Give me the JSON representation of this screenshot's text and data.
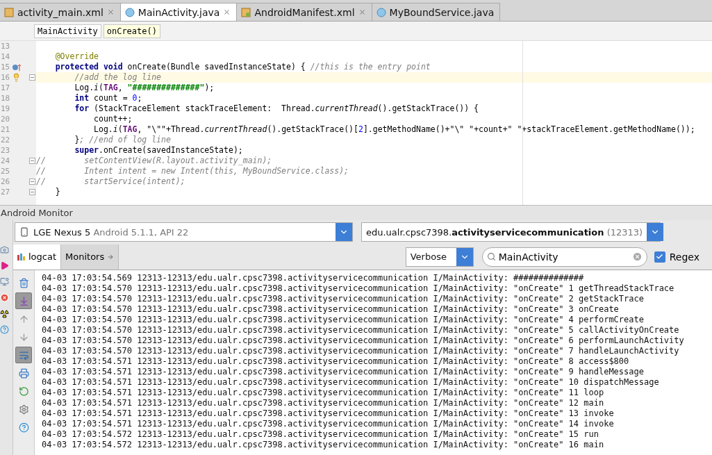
{
  "editor_tabs": [
    {
      "label": "activity_main.xml",
      "kind": "xml",
      "selected": false,
      "closable": true
    },
    {
      "label": "MainActivity.java",
      "kind": "class",
      "selected": true,
      "closable": true
    },
    {
      "label": "AndroidManifest.xml",
      "kind": "manifest",
      "selected": false,
      "closable": true
    },
    {
      "label": "MyBoundService.java",
      "kind": "class",
      "selected": false,
      "closable": false
    }
  ],
  "breadcrumbs": [
    {
      "label": "MainActivity",
      "selected": false
    },
    {
      "label": "onCreate()",
      "selected": true
    }
  ],
  "code_lines": [
    {
      "number": "13",
      "kind": "plain",
      "current": false,
      "fold": false
    },
    {
      "number": "14",
      "kind": "plain",
      "current": false,
      "fold": false,
      "tokens": [
        {
          "kind": "ann",
          "t": "    @Override"
        }
      ]
    },
    {
      "number": "15",
      "kind": "override",
      "current": false,
      "fold": false,
      "tokens": [
        {
          "kind": "kw",
          "t": "    protected void"
        },
        {
          "kind": "plain",
          "t": " onCreate(Bundle savedInstanceState) { "
        },
        {
          "kind": "comment",
          "t": "//this is the entry point"
        }
      ]
    },
    {
      "number": "16",
      "kind": "bulb",
      "current": true,
      "fold": true,
      "tokens": [
        {
          "kind": "comment",
          "t": "        //add the log line"
        }
      ]
    },
    {
      "number": "17",
      "kind": "plain",
      "current": false,
      "fold": false,
      "tokens": [
        {
          "kind": "plain",
          "t": "        Log."
        },
        {
          "kind": "static",
          "t": "i"
        },
        {
          "kind": "plain",
          "t": "("
        },
        {
          "kind": "field",
          "t": "TAG"
        },
        {
          "kind": "plain",
          "t": ", "
        },
        {
          "kind": "str",
          "t": "\"##############\""
        },
        {
          "kind": "plain",
          "t": ");"
        }
      ]
    },
    {
      "number": "18",
      "kind": "plain",
      "current": false,
      "fold": false,
      "tokens": [
        {
          "kind": "kw",
          "t": "        int"
        },
        {
          "kind": "plain",
          "t": " count = "
        },
        {
          "kind": "num",
          "t": "0"
        },
        {
          "kind": "plain",
          "t": ";"
        }
      ]
    },
    {
      "number": "19",
      "kind": "plain",
      "current": false,
      "fold": false,
      "tokens": [
        {
          "kind": "kw",
          "t": "        for"
        },
        {
          "kind": "plain",
          "t": " (StackTraceElement stackTraceElement:  Thread."
        },
        {
          "kind": "static",
          "t": "currentThread"
        },
        {
          "kind": "plain",
          "t": "().getStackTrace()) {"
        }
      ]
    },
    {
      "number": "20",
      "kind": "plain",
      "current": false,
      "fold": false,
      "tokens": [
        {
          "kind": "plain",
          "t": "            count++;"
        }
      ]
    },
    {
      "number": "21",
      "kind": "plain",
      "current": false,
      "fold": false,
      "tokens": [
        {
          "kind": "plain",
          "t": "            Log."
        },
        {
          "kind": "static",
          "t": "i"
        },
        {
          "kind": "plain",
          "t": "("
        },
        {
          "kind": "field",
          "t": "TAG"
        },
        {
          "kind": "plain",
          "t": ", \"\\\"\"+Thread."
        },
        {
          "kind": "static",
          "t": "currentThread"
        },
        {
          "kind": "plain",
          "t": "().getStackTrace()["
        },
        {
          "kind": "num",
          "t": "2"
        },
        {
          "kind": "plain",
          "t": "].getMethodName()+\"\\\" \"+count+\" \"+stackTraceElement.getMethodName());"
        }
      ]
    },
    {
      "number": "22",
      "kind": "plain",
      "current": false,
      "fold": false,
      "tokens": [
        {
          "kind": "plain",
          "t": "        }"
        },
        {
          "kind": "comment",
          "t": "; //end of log line"
        }
      ]
    },
    {
      "number": "23",
      "kind": "plain",
      "current": false,
      "fold": false,
      "tokens": [
        {
          "kind": "kw",
          "t": "        super"
        },
        {
          "kind": "plain",
          "t": ".onCreate(savedInstanceState);"
        }
      ]
    },
    {
      "number": "24",
      "kind": "plain",
      "current": false,
      "fold": true,
      "tokens": [
        {
          "kind": "comment",
          "t": "//        setContentView(R.layout.activity_main);"
        }
      ]
    },
    {
      "number": "25",
      "kind": "plain",
      "current": false,
      "fold": false,
      "tokens": [
        {
          "kind": "comment",
          "t": "//        Intent intent = new Intent(this, MyBoundService.class);"
        }
      ]
    },
    {
      "number": "26",
      "kind": "plain",
      "current": false,
      "fold": true,
      "tokens": [
        {
          "kind": "comment",
          "t": "//        startService(intent);"
        }
      ]
    },
    {
      "number": "27",
      "kind": "plain",
      "current": false,
      "fold": true,
      "tokens": [
        {
          "kind": "plain",
          "t": "    }"
        }
      ]
    }
  ],
  "monitor": {
    "title": "Android Monitor",
    "device": {
      "name": "LGE Nexus 5",
      "detail": "Android 5.1.1, API 22"
    },
    "process": {
      "name": "edu.ualr.cpsc7398.**activityservicecommunication**",
      "pid": "(12313)"
    },
    "tabs": [
      {
        "label": "logcat",
        "selected": true
      },
      {
        "label": "Monitors",
        "selected": false
      }
    ],
    "level_filter": "Verbose",
    "search": {
      "value": "MainActivity"
    },
    "regex": {
      "label": "Regex",
      "checked": true
    },
    "toolbar": [
      {
        "kind": "trash",
        "on": false
      },
      {
        "kind": "scroll-end",
        "on": true
      },
      {
        "kind": "up",
        "on": false
      },
      {
        "kind": "down",
        "on": false
      },
      {
        "kind": "wrap",
        "on": true
      },
      {
        "kind": "print",
        "on": false
      },
      {
        "kind": "restart",
        "on": false
      },
      {
        "kind": "settings",
        "on": false
      },
      {
        "kind": "help",
        "on": false
      }
    ],
    "log_lines": [
      "04-03 17:03:54.569 12313-12313/edu.ualr.cpsc7398.activityservicecommunication I/MainActivity: ##############",
      "04-03 17:03:54.570 12313-12313/edu.ualr.cpsc7398.activityservicecommunication I/MainActivity: \"onCreate\" 1 getThreadStackTrace",
      "04-03 17:03:54.570 12313-12313/edu.ualr.cpsc7398.activityservicecommunication I/MainActivity: \"onCreate\" 2 getStackTrace",
      "04-03 17:03:54.570 12313-12313/edu.ualr.cpsc7398.activityservicecommunication I/MainActivity: \"onCreate\" 3 onCreate",
      "04-03 17:03:54.570 12313-12313/edu.ualr.cpsc7398.activityservicecommunication I/MainActivity: \"onCreate\" 4 performCreate",
      "04-03 17:03:54.570 12313-12313/edu.ualr.cpsc7398.activityservicecommunication I/MainActivity: \"onCreate\" 5 callActivityOnCreate",
      "04-03 17:03:54.570 12313-12313/edu.ualr.cpsc7398.activityservicecommunication I/MainActivity: \"onCreate\" 6 performLaunchActivity",
      "04-03 17:03:54.570 12313-12313/edu.ualr.cpsc7398.activityservicecommunication I/MainActivity: \"onCreate\" 7 handleLaunchActivity",
      "04-03 17:03:54.571 12313-12313/edu.ualr.cpsc7398.activityservicecommunication I/MainActivity: \"onCreate\" 8 access$800",
      "04-03 17:03:54.571 12313-12313/edu.ualr.cpsc7398.activityservicecommunication I/MainActivity: \"onCreate\" 9 handleMessage",
      "04-03 17:03:54.571 12313-12313/edu.ualr.cpsc7398.activityservicecommunication I/MainActivity: \"onCreate\" 10 dispatchMessage",
      "04-03 17:03:54.571 12313-12313/edu.ualr.cpsc7398.activityservicecommunication I/MainActivity: \"onCreate\" 11 loop",
      "04-03 17:03:54.571 12313-12313/edu.ualr.cpsc7398.activityservicecommunication I/MainActivity: \"onCreate\" 12 main",
      "04-03 17:03:54.571 12313-12313/edu.ualr.cpsc7398.activityservicecommunication I/MainActivity: \"onCreate\" 13 invoke",
      "04-03 17:03:54.571 12313-12313/edu.ualr.cpsc7398.activityservicecommunication I/MainActivity: \"onCreate\" 14 invoke",
      "04-03 17:03:54.572 12313-12313/edu.ualr.cpsc7398.activityservicecommunication I/MainActivity: \"onCreate\" 15 run",
      "04-03 17:03:54.572 12313-12313/edu.ualr.cpsc7398.activityservicecommunication I/MainActivity: \"onCreate\" 16 main"
    ]
  }
}
